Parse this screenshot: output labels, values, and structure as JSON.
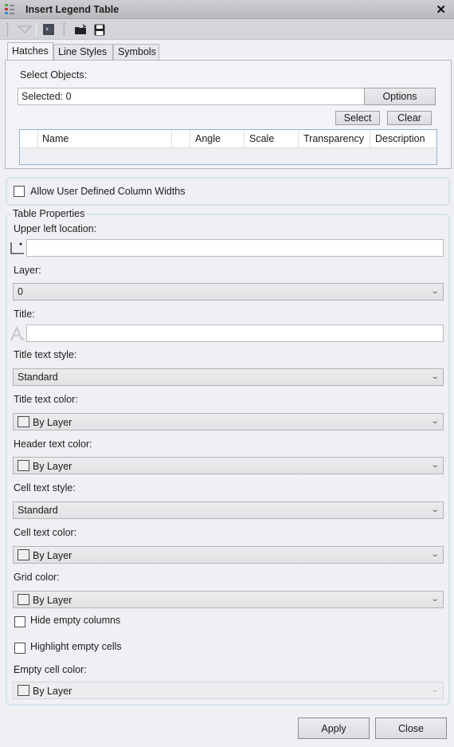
{
  "window": {
    "title": "Insert Legend Table",
    "close_icon": "close-x-icon"
  },
  "toolbar": {
    "icons": [
      "dropdown-triangle-icon",
      "command-window-icon",
      "open-folder-icon",
      "save-disk-icon"
    ]
  },
  "tabs": [
    {
      "label": "Hatches",
      "active": true
    },
    {
      "label": "Line Styles",
      "active": false
    },
    {
      "label": "Symbols",
      "active": false
    }
  ],
  "hatches": {
    "select_objects_label": "Select Objects:",
    "selected_value": "Selected: 0",
    "options_label": "Options",
    "select_label": "Select",
    "clear_label": "Clear",
    "columns": [
      "",
      "Name",
      "",
      "Angle",
      "Scale",
      "Transparency",
      "Description"
    ]
  },
  "allow_user_defined_column_widths": {
    "label": "Allow User Defined Column Widths",
    "checked": false
  },
  "table_properties": {
    "group_label": "Table Properties",
    "upper_left_location": {
      "label": "Upper left location:",
      "value": "",
      "icon": "pick-point-icon"
    },
    "layer": {
      "label": "Layer:",
      "value": "0"
    },
    "title": {
      "label": "Title:",
      "value": "",
      "icon": "text-style-icon"
    },
    "title_text_style": {
      "label": "Title text style:",
      "value": "Standard"
    },
    "title_text_color": {
      "label": "Title text color:",
      "value": "By Layer"
    },
    "header_text_color": {
      "label": "Header text color:",
      "value": "By Layer"
    },
    "cell_text_style": {
      "label": "Cell text style:",
      "value": "Standard"
    },
    "cell_text_color": {
      "label": "Cell text color:",
      "value": "By Layer"
    },
    "grid_color": {
      "label": "Grid color:",
      "value": "By Layer"
    },
    "hide_empty_columns": {
      "label": "Hide empty columns",
      "checked": false
    },
    "highlight_empty_cells": {
      "label": "Highlight empty cells",
      "checked": false
    },
    "empty_cell_color": {
      "label": "Empty cell color:",
      "value": "By Layer",
      "enabled": false
    }
  },
  "footer": {
    "apply_label": "Apply",
    "close_label": "Close"
  }
}
